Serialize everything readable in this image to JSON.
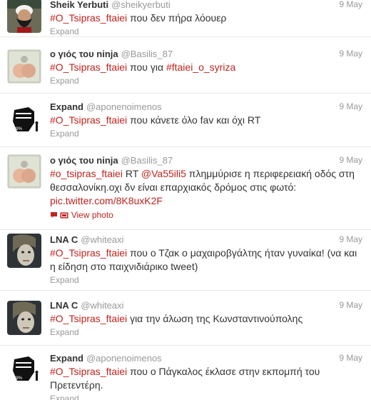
{
  "colors": {
    "hashtag": "#c0231c",
    "meta": "#999999",
    "text": "#333333",
    "divider": "#e8e8e8"
  },
  "tweets": [
    {
      "name": "Sheik Yerbuti",
      "username": "@sheikyerbuti",
      "time": "9 May",
      "avatar_icon": "bearded-man-avatar-icon",
      "hashtag1": "#O_Tsipras_ftaiei",
      "text1": "που δεν πήρα λόουερ",
      "action": "Expand"
    },
    {
      "name": "ο γιός του ninja",
      "username": "@Basilis_87",
      "time": "9 May",
      "avatar_icon": "cartoon-avatar-icon",
      "hashtag1": "#O_Tsipras_ftaiei",
      "text1": "που για",
      "hashtag2": "#ftaiei_o_syriza",
      "action": "Expand"
    },
    {
      "name": "Expand",
      "username": "@aponenoimenos",
      "time": "9 May",
      "avatar_icon": "raised-fist-avatar-icon",
      "hashtag1": "#O_Tsipras_ftaiei",
      "text1": "που κάνετε όλο fav και όχι RT",
      "action": "Expand"
    },
    {
      "name": "ο γιός του ninja",
      "username": "@Basilis_87",
      "time": "9 May",
      "avatar_icon": "cartoon-avatar-icon",
      "hashtag1": "#o_tsipras_ftaiei",
      "text1": "RT",
      "mention": "@Va55ili5",
      "text2": "πλημμύρισε η περιφερειακή οδός στη θεσσαλονίκη.οχι δν είναι επαρχιακός δρόμος στις φωτό:",
      "link": "pic.twitter.com/8K8uxK2F",
      "action": "View photo"
    },
    {
      "name": "LNA C",
      "username": "@whiteaxi",
      "time": "9 May",
      "avatar_icon": "portrait-avatar-icon",
      "hashtag1": "#O_Tsipras_ftaiei",
      "text1": "που ο Τζακ ο μαχαιροβγάλτης ήταν γυναίκα! (να και η είδηση στο παιχνιδιάρικο tweet)",
      "action": "Expand"
    },
    {
      "name": "LNA C",
      "username": "@whiteaxi",
      "time": "9 May",
      "avatar_icon": "portrait-avatar-icon",
      "hashtag1": "#O_Tsipras_ftaiei",
      "text1": "για την άλωση της Κωνσταντινούπολης",
      "action": "Expand"
    },
    {
      "name": "Expand",
      "username": "@aponenoimenos",
      "time": "9 May",
      "avatar_icon": "raised-fist-avatar-icon",
      "hashtag1": "#O_Tsipras_ftaiei",
      "text1": "που ο Πάγκαλος έκλασε στην εκπομπή του Πρετεντέρη.",
      "action": "Expand"
    }
  ]
}
